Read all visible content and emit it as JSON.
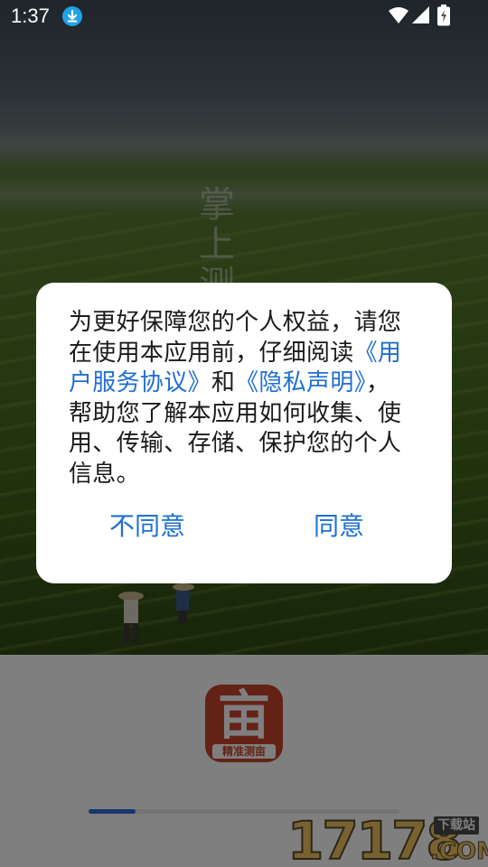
{
  "status_bar": {
    "time": "1:37",
    "icons": [
      "download-icon",
      "wifi-icon",
      "signal-icon",
      "battery-charging-icon"
    ]
  },
  "splash": {
    "vertical_title": "掌上测"
  },
  "dialog": {
    "text_before": "为更好保障您的个人权益，请您在使用本应用前，仔细阅读",
    "link_agreement": "《用户服务协议》",
    "text_and": "和",
    "link_privacy": "《隐私声明》",
    "text_after": "，帮助您了解本应用如何收集、使用、传输、存储、保护您的个人信息。",
    "disagree_label": "不同意",
    "agree_label": "同意",
    "link_color": "#1f6fd1"
  },
  "app": {
    "logo_glyph": "亩",
    "logo_caption": "精准测亩"
  },
  "progress": {
    "fraction": 0.15
  },
  "watermark": {
    "number": "17178",
    "badge": "下载站",
    "suffix": ".COM"
  }
}
